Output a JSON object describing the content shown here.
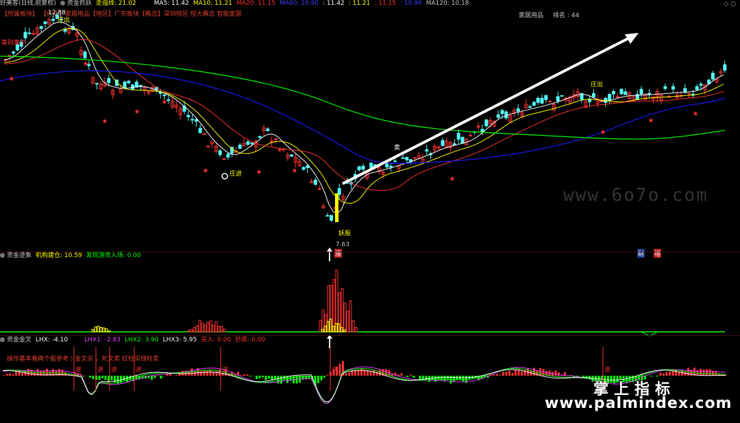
{
  "header": {
    "title": "好美客(日线,前复权)",
    "indicator1": "资金抓妖",
    "strong_line": "走强线: 21.02",
    "ma5": "MA5: 11.42",
    "ma10": "MA10: 11.21",
    "ma20": "MA20: 11.15",
    "ma60": "MA60: 10.90",
    "ohlc1": ": 11.42",
    "ohlc2": ": 11.21",
    "ohlc3": ": 11.15",
    "ohlc4": ": 10.90",
    "ma120": "MA120: 10.18",
    "corner_icons": "◇ ○"
  },
  "tagline": "【所属板块】 【行业】家居用品【地区】广东板块【概念】深圳特区 恒大概念 智能家居",
  "sector": {
    "name": "家居用品",
    "rank": "排名 : 44"
  },
  "price_labels": {
    "high": "12.88",
    "low": "7.63",
    "zhuang_chu_1": "庄出",
    "zhuang_chu_2": "庄出",
    "zhuang_jin": "庄进",
    "yao_gu": "妖股",
    "mai": "卖",
    "left_label": "筹码集中",
    "zhang": "涨",
    "cai": "财",
    "zeng": "增"
  },
  "sub1": {
    "name": "资金迹象",
    "inst": "机构建仓: 10.59",
    "hot": "发现游资入场: 0.00"
  },
  "sub2": {
    "name": "资金金叉",
    "lhx": "LHX: -4.10",
    "lhx1": "LHX1: -2.83",
    "lhx2": "LHX2: 3.90",
    "lhx3": "LHX3: 5.95",
    "buy": "买入: 0.00",
    "sell": "抄底: 0.00",
    "note": "操作基本看两个股参考 ) 金叉买 ，死叉卖 红柱买绿柱卖",
    "jin": "进"
  },
  "watermarks": {
    "site1": "www.6o7o.com",
    "brand": "掌上指标",
    "site2": "www.palmindex.com"
  },
  "colors": {
    "up": "#ff3232",
    "down": "#54fcfc",
    "ma5": "#ffffff",
    "ma10": "#ffff00",
    "ma20": "#ff3232",
    "ma60": "#1a1aff",
    "ma120": "#00ff00",
    "accent_yellow": "#ffff00"
  }
}
